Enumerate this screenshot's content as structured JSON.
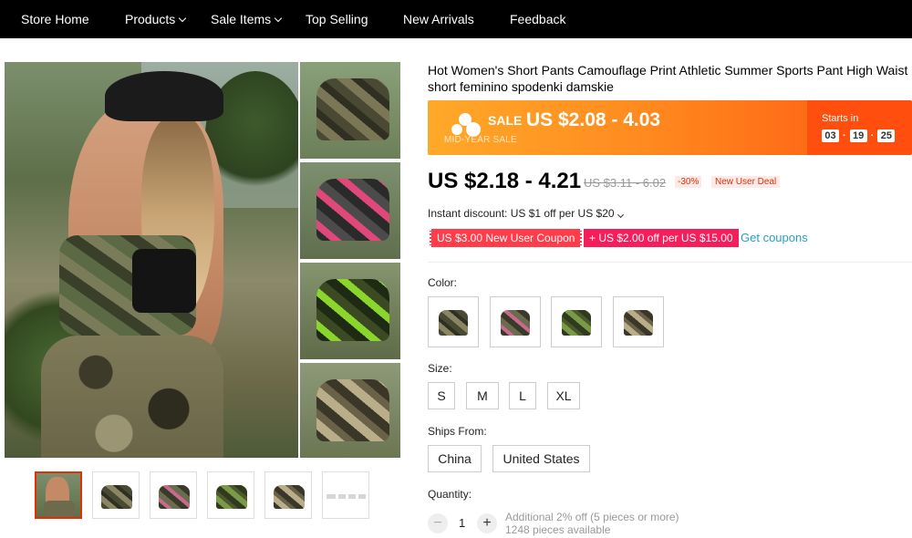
{
  "nav": {
    "items": [
      {
        "label": "Store Home",
        "dropdown": false
      },
      {
        "label": "Products",
        "dropdown": true
      },
      {
        "label": "Sale Items",
        "dropdown": true
      },
      {
        "label": "Top Selling",
        "dropdown": false
      },
      {
        "label": "New Arrivals",
        "dropdown": false
      },
      {
        "label": "Feedback",
        "dropdown": false
      }
    ]
  },
  "product": {
    "title": "Hot Women's Short Pants Camouflage Print Athletic Summer Sports Pant High Waist short feminino spodenki damskie",
    "sale_banner": {
      "label": "SALE",
      "price": "US $2.08 - 4.03",
      "subtitle": "MID-YEAR SALE",
      "starts_in_label": "Starts in",
      "timer": {
        "hours": "03",
        "minutes": "19",
        "seconds": "25"
      }
    },
    "price": "US $2.18 - 4.21",
    "old_price": "US $3.11 - 6.02",
    "discount": "-30%",
    "new_user_deal": "New User Deal",
    "instant_discount": "Instant discount: US $1 off per US $20",
    "coupons": [
      "US $3.00 New User Coupon",
      "+ US $2.00 off per US $15.00"
    ],
    "get_coupons": "Get coupons",
    "color_label": "Color:",
    "size_label": "Size:",
    "sizes": [
      "S",
      "M",
      "L",
      "XL"
    ],
    "ships_from_label": "Ships From:",
    "ships_from": [
      "China",
      "United States"
    ],
    "quantity_label": "Quantity:",
    "quantity": "1",
    "quantity_minus": "−",
    "quantity_plus": "+",
    "quantity_note_1": "Additional 2% off (5 pieces or more)",
    "quantity_note_2": "1248 pieces available"
  },
  "colors": {
    "accent": "#e62e04",
    "nav_bg": "#000000",
    "link": "#2a9fc0",
    "sale_orange": "#ff8a1f"
  },
  "icons": {
    "dropdown": "chevron-down-icon",
    "plus": "plus-icon",
    "minus": "minus-icon"
  }
}
